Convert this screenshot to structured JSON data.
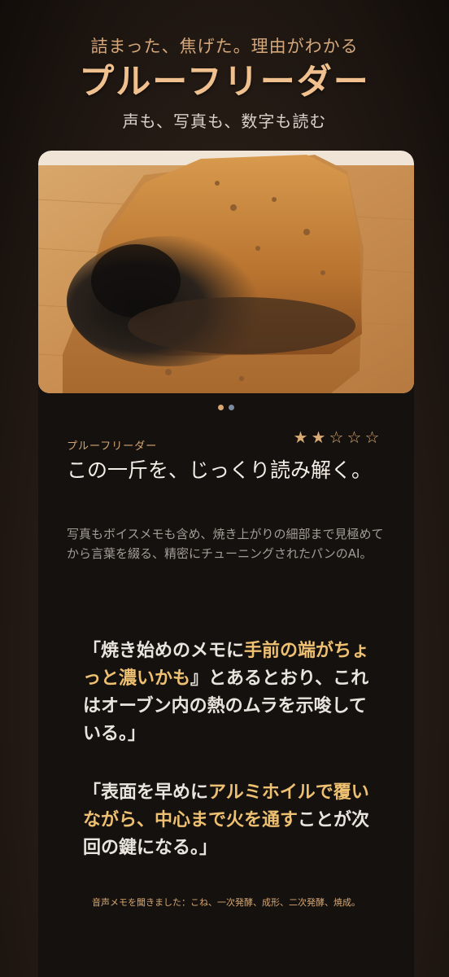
{
  "header": {
    "tagline": "詰まった、焦げた。理由がわかる",
    "title": "プルーフリーダー",
    "subtitle": "声も、写真も、数字も読む"
  },
  "card": {
    "photo_alt": "焦げたパン",
    "carousel": {
      "current": 1,
      "total": 2
    },
    "reader_label": "プルーフリーダー",
    "rating": {
      "value": 2,
      "max": 5,
      "filled_star": "★",
      "empty_star": "☆"
    },
    "headline": "この一斤を、じっくり読み解く。",
    "description": "写真もボイスメモも含め、焼き上がりの細部まで見極めてから言葉を綴る、精密にチューニングされたパンのAI。",
    "quotes": [
      {
        "before": "「焼き始めのメモに",
        "highlight": "手前の端がちょっと濃いかも",
        "after": "』とあるとおり、これはオーブン内の熱のムラを示唆している。」"
      },
      {
        "before": "「表面を早めに",
        "highlight": "アルミホイルで覆いながら、中心まで火を通す",
        "after": "ことが次回の鍵になる。」"
      }
    ],
    "footnote": "音声メモを聞きました：こね、一次発酵、成形、二次発酵、焼成。"
  },
  "colors": {
    "accent": "#d7a872",
    "title": "#f0c18f",
    "highlight": "#eec072",
    "card_bg": "#15110e"
  }
}
